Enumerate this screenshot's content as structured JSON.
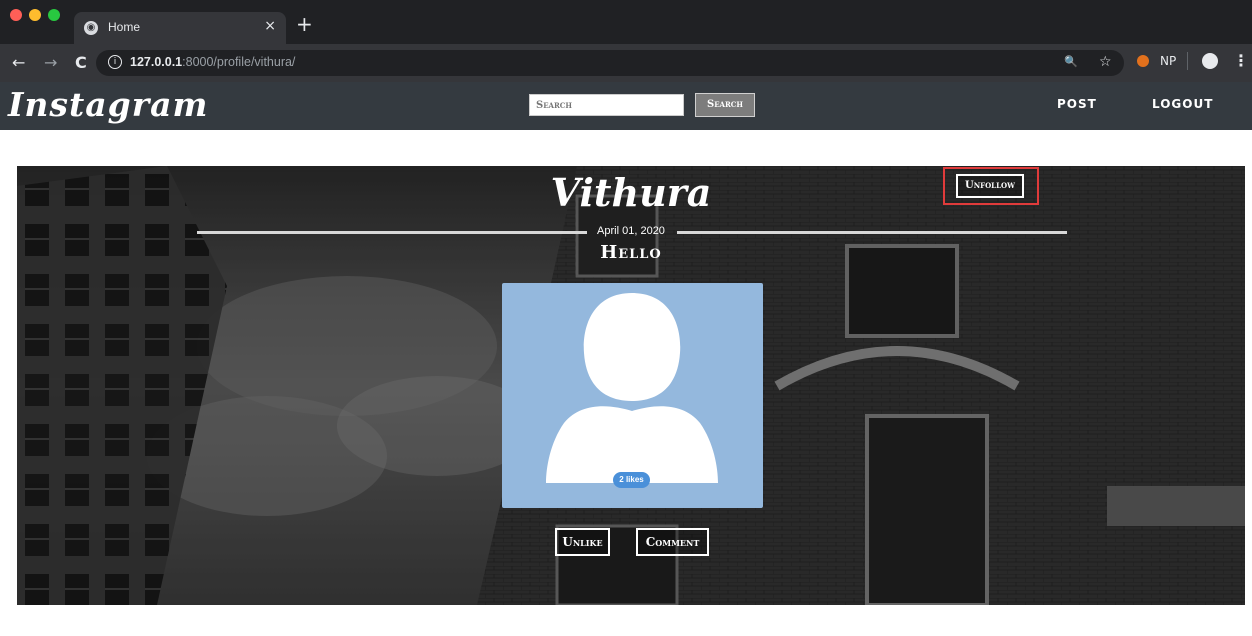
{
  "browser": {
    "tab_title": "Home",
    "tab_close": "×",
    "new_tab": "+",
    "url_host": "127.0.0.1",
    "url_path": ":8000/profile/vithura/",
    "back": "←",
    "forward": "→",
    "reload": "C",
    "zoom_icon": "🔍",
    "star_icon": "☆",
    "extension_np": "NP",
    "menu": "⋮"
  },
  "site": {
    "brand": "Instagram",
    "search_placeholder": "Search",
    "search_button": "Search",
    "nav_post": "POST",
    "nav_logout": "LOGOUT"
  },
  "profile": {
    "name": "Vithura",
    "unfollow_label": "Unfollow"
  },
  "post": {
    "date": "April 01, 2020",
    "title": "Hello",
    "likes": "2 likes",
    "unlike_label": "Unlike",
    "comment_label": "Comment"
  },
  "colors": {
    "header_bg": "#343a40",
    "highlight": "#e03b3b",
    "image_bg": "#94b8dd"
  }
}
